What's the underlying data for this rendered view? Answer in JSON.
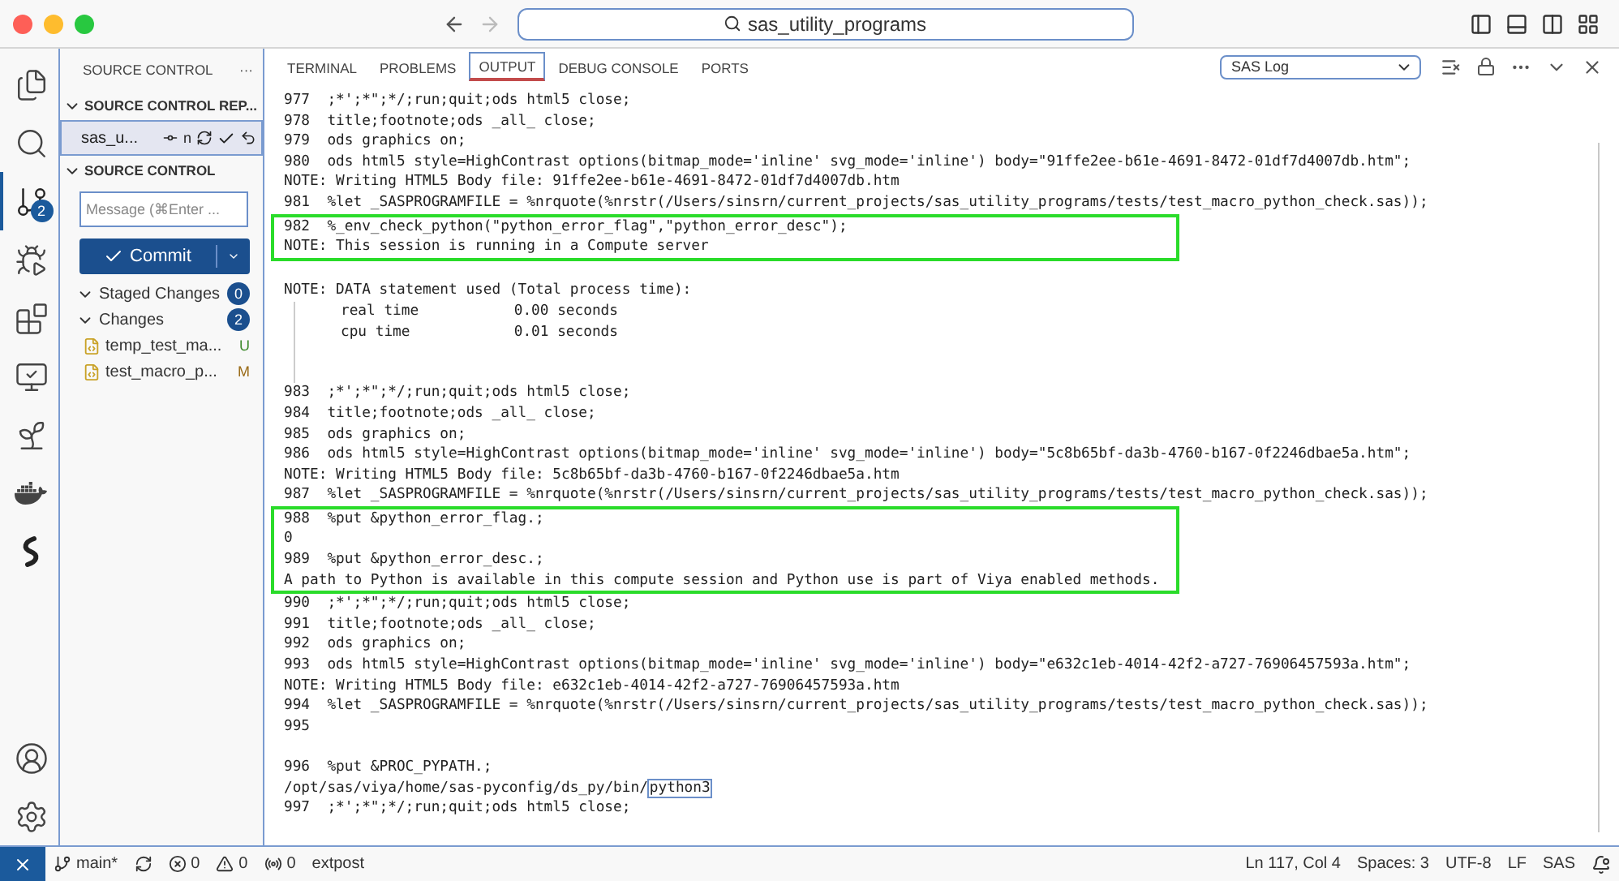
{
  "title_bar": {
    "search": "sas_utility_programs"
  },
  "activity_bar": [
    {
      "kind": "files",
      "selected": false
    },
    {
      "kind": "search",
      "selected": false
    },
    {
      "kind": "scm",
      "selected": true,
      "badge": "2"
    },
    {
      "kind": "debug",
      "selected": false
    },
    {
      "kind": "extensions",
      "selected": false
    },
    {
      "kind": "remote",
      "selected": false
    },
    {
      "kind": "tree",
      "selected": false
    },
    {
      "kind": "docker",
      "selected": false
    },
    {
      "kind": "sas",
      "selected": false
    }
  ],
  "activity_bottom": [
    {
      "kind": "account"
    },
    {
      "kind": "settings"
    }
  ],
  "sidebar": {
    "title": "SOURCE CONTROL",
    "more": "···",
    "repos_section": {
      "title": "SOURCE CONTROL REP...",
      "expanded": true,
      "repo": {
        "name": "sas_u...",
        "branch": "n",
        "selected": true
      }
    },
    "scm_section": {
      "title": "SOURCE CONTROL",
      "expanded": true,
      "message_placeholder": "Message (⌘Enter ...",
      "commit": "Commit",
      "groups": [
        {
          "label": "Staged Changes",
          "count": "0",
          "expanded": true
        },
        {
          "label": "Changes",
          "count": "2",
          "expanded": true,
          "files": [
            {
              "name": "temp_test_ma...",
              "status": "U",
              "color": "#3d8a2b"
            },
            {
              "name": "test_macro_p...",
              "status": "M",
              "color": "#9a6b17"
            }
          ]
        }
      ]
    }
  },
  "panel": {
    "tabs": [
      {
        "label": "TERMINAL",
        "selected": false
      },
      {
        "label": "PROBLEMS",
        "selected": false
      },
      {
        "label": "OUTPUT",
        "selected": true
      },
      {
        "label": "DEBUG CONSOLE",
        "selected": false
      },
      {
        "label": "PORTS",
        "selected": false
      }
    ],
    "channel": "SAS Log",
    "log_blocks": [
      {
        "highlighted": false,
        "lines": [
          {
            "kind": "code",
            "number": "977",
            "text": ";*';*\";*/;run;quit;ods html5 close;"
          },
          {
            "kind": "code",
            "number": "978",
            "text": "title;footnote;ods _all_ close;"
          },
          {
            "kind": "code",
            "number": "979",
            "text": "ods graphics on;"
          },
          {
            "kind": "code",
            "number": "980",
            "text": "ods html5 style=HighContrast options(bitmap_mode='inline' svg_mode='inline') body=\"91ffe2ee-b61e-4691-8472-01df7d4007db.htm\";"
          },
          {
            "kind": "note",
            "text": "NOTE: Writing HTML5 Body file: 91ffe2ee-b61e-4691-8472-01df7d4007db.htm"
          },
          {
            "kind": "code",
            "number": "981",
            "text": "%let _SASPROGRAMFILE = %nrquote(%nrstr(/Users/sinsrn/current_projects/sas_utility_programs/tests/test_macro_python_check.sas));"
          }
        ]
      },
      {
        "highlighted": true,
        "lines": [
          {
            "kind": "code",
            "number": "982",
            "text": "%_env_check_python(\"python_error_flag\",\"python_error_desc\");"
          },
          {
            "kind": "note",
            "text": "NOTE: This session is running in a Compute server"
          }
        ]
      },
      {
        "highlighted": false,
        "lines": [
          {
            "kind": "blank"
          },
          {
            "kind": "note",
            "text": "NOTE: DATA statement used (Total process time):"
          },
          {
            "kind": "detail",
            "text": "real time           0.00 seconds"
          },
          {
            "kind": "detail",
            "text": "cpu time            0.01 seconds"
          },
          {
            "kind": "blank"
          },
          {
            "kind": "blank"
          },
          {
            "kind": "code",
            "number": "983",
            "text": ";*';*\";*/;run;quit;ods html5 close;"
          },
          {
            "kind": "code",
            "number": "984",
            "text": "title;footnote;ods _all_ close;"
          },
          {
            "kind": "code",
            "number": "985",
            "text": "ods graphics on;"
          },
          {
            "kind": "code",
            "number": "986",
            "text": "ods html5 style=HighContrast options(bitmap_mode='inline' svg_mode='inline') body=\"5c8b65bf-da3b-4760-b167-0f2246dbae5a.htm\";"
          },
          {
            "kind": "note",
            "text": "NOTE: Writing HTML5 Body file: 5c8b65bf-da3b-4760-b167-0f2246dbae5a.htm"
          },
          {
            "kind": "code",
            "number": "987",
            "text": "%let _SASPROGRAMFILE = %nrquote(%nrstr(/Users/sinsrn/current_projects/sas_utility_programs/tests/test_macro_python_check.sas));"
          }
        ]
      },
      {
        "highlighted": true,
        "lines": [
          {
            "kind": "code",
            "number": "988",
            "text": "%put &python_error_flag.;"
          },
          {
            "kind": "note",
            "text": "0"
          },
          {
            "kind": "code",
            "number": "989",
            "text": "%put &python_error_desc.;"
          },
          {
            "kind": "note",
            "text": "A path to Python is available in this compute session and Python use is part of Viya enabled methods."
          }
        ]
      },
      {
        "highlighted": false,
        "lines": [
          {
            "kind": "code",
            "number": "990",
            "text": ";*';*\";*/;run;quit;ods html5 close;"
          },
          {
            "kind": "code",
            "number": "991",
            "text": "title;footnote;ods _all_ close;"
          },
          {
            "kind": "code",
            "number": "992",
            "text": "ods graphics on;"
          },
          {
            "kind": "code",
            "number": "993",
            "text": "ods html5 style=HighContrast options(bitmap_mode='inline' svg_mode='inline') body=\"e632c1eb-4014-42f2-a727-76906457593a.htm\";"
          },
          {
            "kind": "note",
            "text": "NOTE: Writing HTML5 Body file: e632c1eb-4014-42f2-a727-76906457593a.htm"
          },
          {
            "kind": "code",
            "number": "994",
            "text": "%let _SASPROGRAMFILE = %nrquote(%nrstr(/Users/sinsrn/current_projects/sas_utility_programs/tests/test_macro_python_check.sas));"
          },
          {
            "kind": "code",
            "number": "995"
          },
          {
            "kind": "blank"
          },
          {
            "kind": "code",
            "number": "996",
            "text": "%put &PROC_PYPATH.;"
          },
          {
            "kind": "note",
            "text": "/opt/sas/viya/home/sas-pyconfig/ds_py/bin/",
            "selection": "python3"
          },
          {
            "kind": "code",
            "number": "997",
            "text": ";*';*\";*/;run;quit;ods html5 close;"
          }
        ]
      }
    ]
  },
  "status_bar": {
    "left": [
      {
        "kind": "remote"
      },
      {
        "kind": "branch",
        "text": "main*"
      },
      {
        "kind": "sync"
      },
      {
        "kind": "errors",
        "text": "0"
      },
      {
        "kind": "warnings",
        "text": "0"
      },
      {
        "kind": "ports",
        "text": "0"
      },
      {
        "kind": "text",
        "text": "extpost"
      }
    ],
    "right": [
      {
        "kind": "text",
        "text": "Ln 117, Col 4"
      },
      {
        "kind": "text",
        "text": "Spaces: 3"
      },
      {
        "kind": "text",
        "text": "UTF-8"
      },
      {
        "kind": "text",
        "text": "LF"
      },
      {
        "kind": "text",
        "text": "SAS"
      },
      {
        "kind": "bell"
      }
    ]
  }
}
